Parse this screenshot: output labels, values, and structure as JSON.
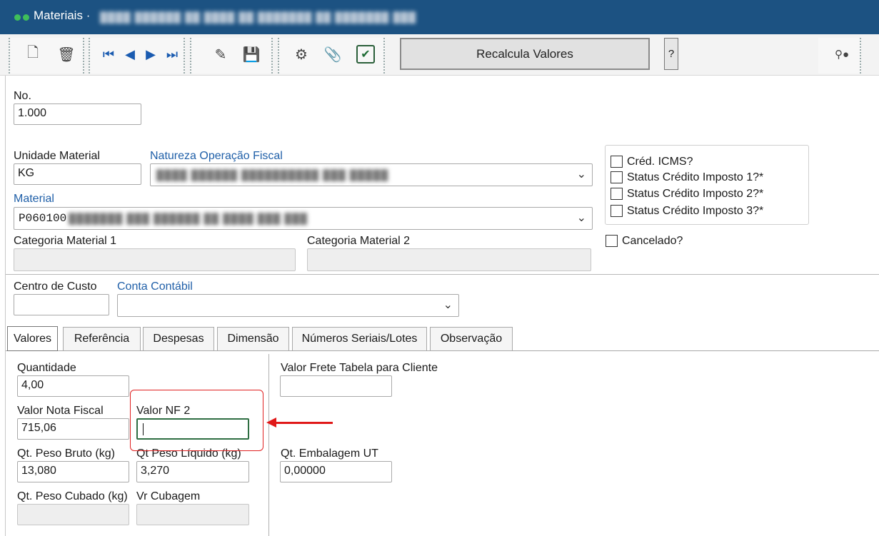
{
  "window": {
    "title": "Materiais",
    "title_suffix": "·"
  },
  "toolbar": {
    "recalc_label": "Recalcula Valores",
    "help_label": "?"
  },
  "form": {
    "no": {
      "label": "No.",
      "value": "1.000"
    },
    "unidade": {
      "label": "Unidade Material",
      "value": "KG"
    },
    "natureza": {
      "label": "Natureza Operação Fiscal",
      "value": ""
    },
    "material": {
      "label": "Material",
      "value": "P060100"
    },
    "categoria1": {
      "label": "Categoria Material 1",
      "value": ""
    },
    "categoria2": {
      "label": "Categoria Material 2",
      "value": ""
    },
    "checkboxes": [
      {
        "label": "Créd. ICMS?",
        "checked": false
      },
      {
        "label": "Status Crédito Imposto 1?*",
        "checked": false
      },
      {
        "label": "Status Crédito Imposto 2?*",
        "checked": false
      },
      {
        "label": "Status Crédito Imposto 3?*",
        "checked": false
      }
    ],
    "cancelado": {
      "label": "Cancelado?",
      "checked": false
    },
    "centro_custo": {
      "label": "Centro de Custo",
      "value": ""
    },
    "conta_contabil": {
      "label": "Conta Contábil",
      "value": ""
    }
  },
  "tabs": [
    {
      "label": "Valores",
      "active": true
    },
    {
      "label": "Referência",
      "active": false
    },
    {
      "label": "Despesas",
      "active": false
    },
    {
      "label": "Dimensão",
      "active": false
    },
    {
      "label": "Números Seriais/Lotes",
      "active": false
    },
    {
      "label": "Observação",
      "active": false
    }
  ],
  "valores": {
    "quantidade": {
      "label": "Quantidade",
      "value": "4,00"
    },
    "valor_nf": {
      "label": "Valor Nota Fiscal",
      "value": "715,06"
    },
    "valor_nf2": {
      "label": "Valor NF 2",
      "value": ""
    },
    "peso_bruto": {
      "label": "Qt. Peso Bruto (kg)",
      "value": "13,080"
    },
    "peso_liquido": {
      "label": "Qt Peso Líquido (kg)",
      "value": "3,270"
    },
    "peso_cubado": {
      "label": "Qt. Peso Cubado (kg)",
      "value": ""
    },
    "vr_cubagem": {
      "label": "Vr Cubagem",
      "value": ""
    },
    "frete_tabela": {
      "label": "Valor Frete Tabela para Cliente",
      "value": ""
    },
    "embalagem_ut": {
      "label": "Qt. Embalagem UT",
      "value": "0,00000"
    }
  },
  "colors": {
    "titlebar": "#1c5282",
    "accent_link": "#1f5fa8",
    "highlight": "#e02020"
  }
}
